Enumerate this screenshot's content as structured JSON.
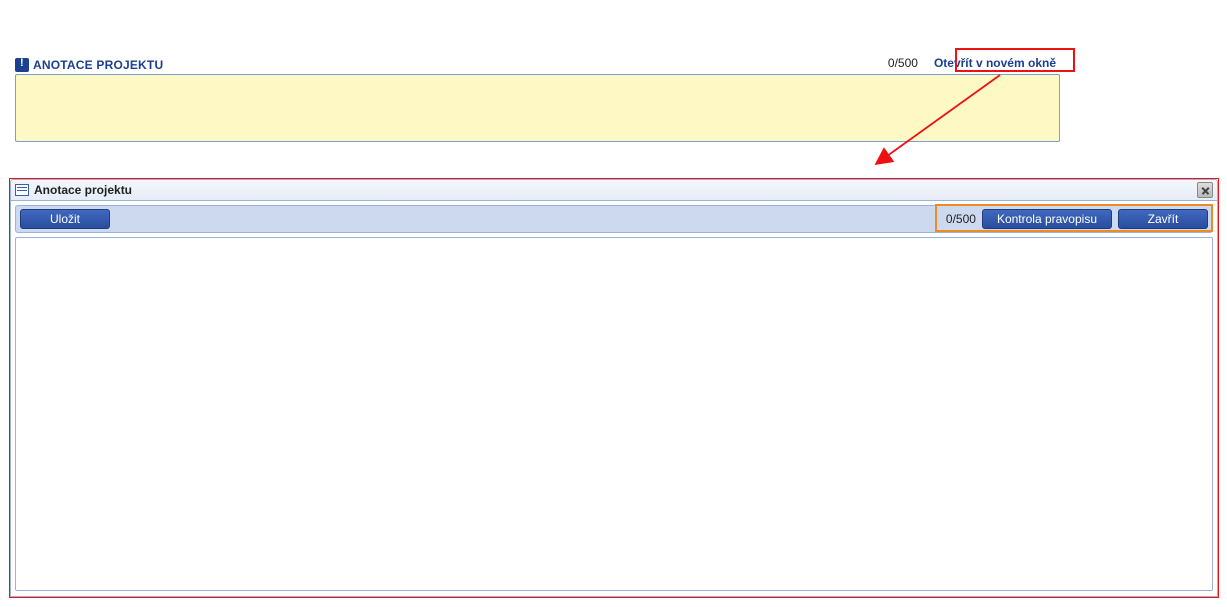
{
  "top": {
    "title": "ANOTACE PROJEKTU",
    "counter": "0/500",
    "open_link": "Otevřít v novém okně"
  },
  "modal": {
    "title": "Anotace projektu",
    "save": "Uložit",
    "counter": "0/500",
    "spellcheck": "Kontrola pravopisu",
    "close": "Zavřít",
    "text": ""
  }
}
